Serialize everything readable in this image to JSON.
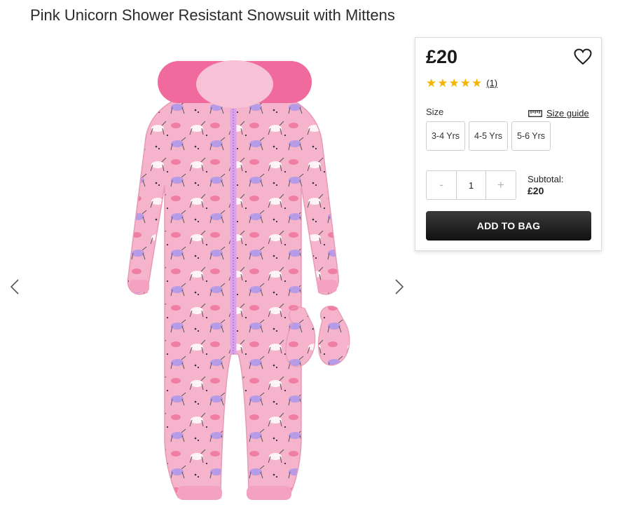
{
  "product": {
    "title": "Pink Unicorn Shower Resistant Snowsuit with Mittens",
    "price": "£20",
    "rating": 5,
    "rating_stars": [
      "★",
      "★",
      "★",
      "★",
      "★"
    ],
    "review_count": "(1)",
    "image_alt": "Pink unicorn print snowsuit with matching mittens"
  },
  "size": {
    "label": "Size",
    "guide_label": "Size guide",
    "options": [
      "3-4 Yrs",
      "4-5 Yrs",
      "5-6 Yrs"
    ]
  },
  "quantity": {
    "minus": "-",
    "value": "1",
    "plus": "+"
  },
  "subtotal": {
    "label": "Subtotal:",
    "value": "£20"
  },
  "actions": {
    "add_to_bag": "ADD TO BAG"
  },
  "icons": {
    "wishlist": "heart-icon",
    "size_guide": "ruler-icon",
    "prev": "chevron-left-icon",
    "next": "chevron-right-icon"
  },
  "colors": {
    "suit_pink": "#f6b3cc",
    "fur_pink": "#f2659b",
    "star_gold": "#f2b500",
    "button_dark": "#1e1e1e"
  }
}
